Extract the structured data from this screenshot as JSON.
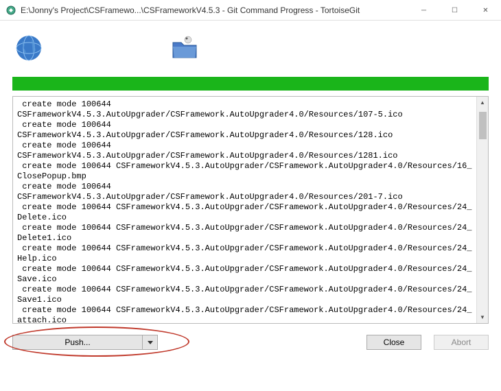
{
  "titlebar": {
    "title": "E:\\Jonny's Project\\CSFramewo...\\CSFrameworkV4.5.3 - Git Command Progress - TortoiseGit"
  },
  "output_lines": [
    " create mode 100644",
    "CSFrameworkV4.5.3.AutoUpgrader/CSFramework.AutoUpgrader4.0/Resources/107-5.ico",
    " create mode 100644",
    "CSFrameworkV4.5.3.AutoUpgrader/CSFramework.AutoUpgrader4.0/Resources/128.ico",
    " create mode 100644",
    "CSFrameworkV4.5.3.AutoUpgrader/CSFramework.AutoUpgrader4.0/Resources/1281.ico",
    " create mode 100644 CSFrameworkV4.5.3.AutoUpgrader/CSFramework.AutoUpgrader4.0/Resources/16_ClosePopup.bmp",
    " create mode 100644",
    "CSFrameworkV4.5.3.AutoUpgrader/CSFramework.AutoUpgrader4.0/Resources/201-7.ico",
    " create mode 100644 CSFrameworkV4.5.3.AutoUpgrader/CSFramework.AutoUpgrader4.0/Resources/24_Delete.ico",
    " create mode 100644 CSFrameworkV4.5.3.AutoUpgrader/CSFramework.AutoUpgrader4.0/Resources/24_Delete1.ico",
    " create mode 100644 CSFrameworkV4.5.3.AutoUpgrader/CSFramework.AutoUpgrader4.0/Resources/24_Help.ico",
    " create mode 100644 CSFrameworkV4.5.3.AutoUpgrader/CSFramework.AutoUpgrader4.0/Resources/24_Save.ico",
    " create mode 100644 CSFrameworkV4.5.3.AutoUpgrader/CSFramework.AutoUpgrader4.0/Resources/24_Save1.ico",
    " create mode 100644 CSFrameworkV4.5.3.AutoUpgrader/CSFramework.AutoUpgrader4.0/Resources/24_attach.ico"
  ],
  "buttons": {
    "push": "Push...",
    "close": "Close",
    "abort": "Abort"
  }
}
